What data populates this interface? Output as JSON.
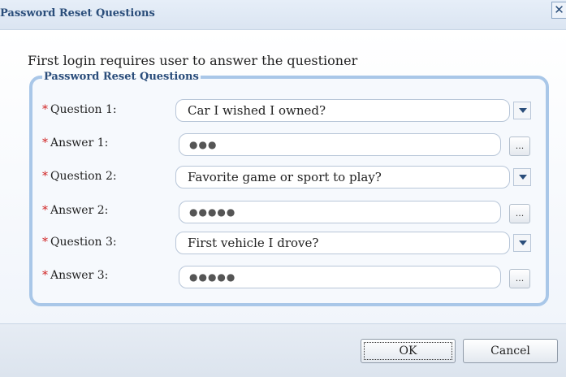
{
  "dialog": {
    "title": "Password Reset Questions",
    "close_glyph": "✕"
  },
  "intro_text": "First login requires user to answer the questioner",
  "group_legend": "Password Reset Questions",
  "required_marker": "*",
  "fields": [
    {
      "kind": "question",
      "label": "Question 1:",
      "value": "Car I wished I owned?"
    },
    {
      "kind": "answer",
      "label": "Answer 1:",
      "value": "●●●",
      "button": "..."
    },
    {
      "kind": "question",
      "label": "Question 2:",
      "value": "Favorite game or sport to play?"
    },
    {
      "kind": "answer",
      "label": "Answer 2:",
      "value": "●●●●●",
      "button": "..."
    },
    {
      "kind": "question",
      "label": "Question 3:",
      "value": "First vehicle I drove?"
    },
    {
      "kind": "answer",
      "label": "Answer 3:",
      "value": "●●●●●",
      "button": "..."
    }
  ],
  "buttons": {
    "ok": "OK",
    "cancel": "Cancel"
  },
  "colors": {
    "title_text": "#2a4d7a",
    "group_border": "#a9c7e8",
    "required": "#d02020"
  }
}
